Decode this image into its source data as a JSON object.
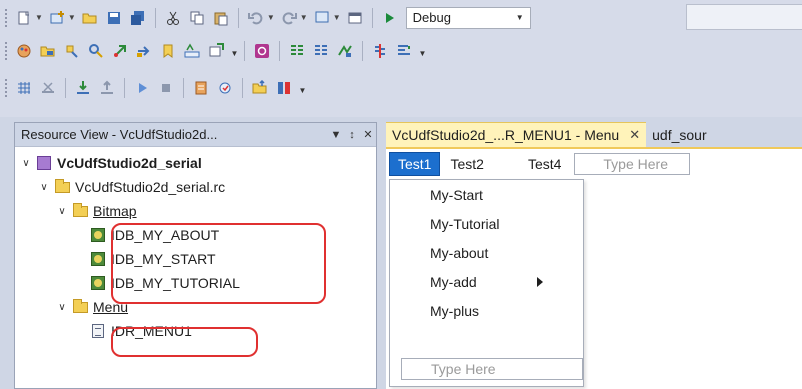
{
  "toolbar": {
    "configuration": "Debug"
  },
  "resource_view": {
    "title": "Resource View - VcUdfStudio2d...",
    "pin_glyph": "▼",
    "autohide_glyph": "↕",
    "close_glyph": "✕",
    "project": "VcUdfStudio2d_serial",
    "rc_file": "VcUdfStudio2d_serial.rc",
    "bitmap_folder": "Bitmap",
    "bitmaps": [
      "IDB_MY_ABOUT",
      "IDB_MY_START",
      "IDB_MY_TUTORIAL"
    ],
    "menu_folder": "Menu",
    "menus": [
      "IDR_MENU1"
    ]
  },
  "editor": {
    "active_tab": "VcUdfStudio2d_...R_MENU1 - Menu",
    "tab_close": "✕",
    "inactive_tab": "udf_sour",
    "menu_bar": [
      "Test1",
      "Test2",
      "Test4"
    ],
    "type_here": "Type Here",
    "dropdown_items": [
      "My-Start",
      "My-Tutorial",
      "My-about",
      "My-add",
      "My-plus"
    ],
    "dropdown_type_here": "Type Here"
  },
  "colors": {
    "accent_blue": "#1c6fce",
    "highlight_red": "#e03030",
    "active_tab_yellow": "#fff3ba"
  }
}
